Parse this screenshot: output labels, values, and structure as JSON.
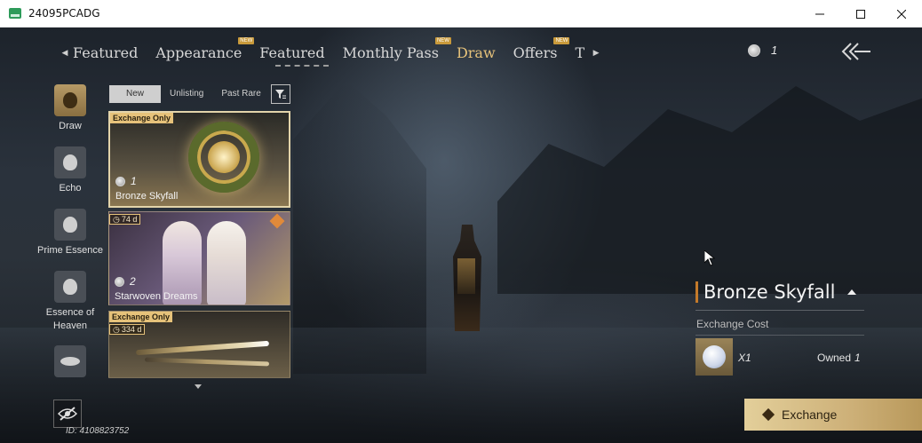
{
  "window": {
    "title": "24095PCADG",
    "controls": [
      "minimize-icon",
      "maximize-icon",
      "close-icon"
    ]
  },
  "topnav": {
    "tabs": [
      {
        "label": "Featured",
        "active": false,
        "new": false
      },
      {
        "label": "Appearance",
        "active": false,
        "new": true,
        "badge": "NEW"
      },
      {
        "label": "Featured",
        "active": false,
        "new": false
      },
      {
        "label": "Monthly Pass",
        "active": false,
        "new": true,
        "badge": "NEW"
      },
      {
        "label": "Draw",
        "active": true,
        "new": false
      },
      {
        "label": "Offers",
        "active": false,
        "new": true,
        "badge": "NEW"
      }
    ],
    "truncated_tab": "T",
    "left_arrow_icon": "caret-left-icon",
    "right_arrow_icon": "caret-right-icon"
  },
  "currency": {
    "icon": "coin-icon",
    "amount": "1"
  },
  "back_icon": "double-chevron-back-icon",
  "sidemenu": {
    "items": [
      {
        "label": "Draw",
        "active": true,
        "icon": "draw-icon"
      },
      {
        "label": "Echo",
        "active": false,
        "icon": "echo-icon"
      },
      {
        "label": "Prime Essence",
        "active": false,
        "icon": "prime-essence-icon"
      },
      {
        "label": "Essence of Heaven",
        "active": false,
        "icon": "essence-of-heaven-icon"
      },
      {
        "label": "",
        "active": false,
        "icon": "lips-icon"
      }
    ]
  },
  "subtabs": {
    "items": [
      {
        "label": "New",
        "active": true
      },
      {
        "label": "Unlisting",
        "active": false
      },
      {
        "label": "Past Rare",
        "active": false
      }
    ],
    "filter_icon": "filter-icon"
  },
  "cards": [
    {
      "tag": "Exchange Only",
      "timer": "",
      "qty": "1",
      "name": "Bronze Skyfall",
      "selected": true
    },
    {
      "tag": "",
      "timer": "74 d",
      "qty": "2",
      "name": "Starwoven Dreams",
      "selected": false
    },
    {
      "tag": "Exchange Only",
      "timer": "334 d",
      "qty": "",
      "name": "",
      "selected": false
    }
  ],
  "footer": {
    "uid": "ID: 4108823752",
    "hide_icon": "eye-slash-icon"
  },
  "detail": {
    "title": "Bronze Skyfall",
    "cost_label": "Exchange Cost",
    "cost_qty": "X1",
    "owned_label": "Owned",
    "owned_value": "1",
    "exchange_label": "Exchange"
  },
  "colors": {
    "accent_gold": "#e6c27a",
    "title_bar_accent": "#c47a2a",
    "button_gold": "#cdb078"
  }
}
